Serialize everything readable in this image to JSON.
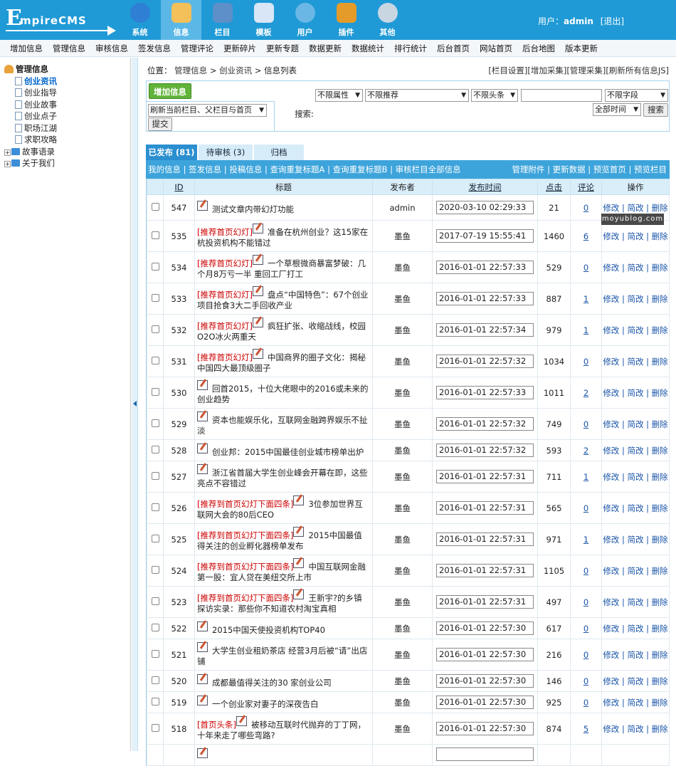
{
  "app": {
    "logo": "EmpireCMS",
    "logo_big": "E",
    "logo_small": "mpireCMS"
  },
  "topnav": [
    {
      "label": "系统",
      "icon": "globe-icon",
      "active": false
    },
    {
      "label": "信息",
      "icon": "edit-note-icon",
      "active": true
    },
    {
      "label": "栏目",
      "icon": "folder-icon",
      "active": false
    },
    {
      "label": "模板",
      "icon": "window-icon",
      "active": false
    },
    {
      "label": "用户",
      "icon": "user-icon",
      "active": false
    },
    {
      "label": "插件",
      "icon": "tools-icon",
      "active": false
    },
    {
      "label": "其他",
      "icon": "gear-icon",
      "active": false
    }
  ],
  "user": {
    "prefix": "用户：",
    "name": "admin",
    "logout": "[退出]"
  },
  "subnav": [
    "增加信息",
    "管理信息",
    "审核信息",
    "签发信息",
    "管理评论",
    "更新碎片",
    "更新专题",
    "数据更新",
    "数据统计",
    "排行统计",
    "后台首页",
    "网站首页",
    "后台地图",
    "版本更新"
  ],
  "tree": {
    "root": "管理信息",
    "items": [
      {
        "label": "创业资讯",
        "type": "doc",
        "selected": true
      },
      {
        "label": "创业指导",
        "type": "doc"
      },
      {
        "label": "创业故事",
        "type": "doc"
      },
      {
        "label": "创业点子",
        "type": "doc"
      },
      {
        "label": "职场江湖",
        "type": "doc"
      },
      {
        "label": "求职攻略",
        "type": "doc"
      },
      {
        "label": "故事语录",
        "type": "folder"
      },
      {
        "label": "关于我们",
        "type": "folder"
      }
    ]
  },
  "location": {
    "prefix": "位置：",
    "crumb1": "管理信息",
    "sep": ">",
    "crumb2": "创业资讯",
    "crumb3": "信息列表"
  },
  "toplinks": [
    "[栏目设置]",
    "[增加采集]",
    "[管理采集]",
    "[刷新所有信息JS]"
  ],
  "actions": {
    "add": "增加信息",
    "refresh_select": "刷新当前栏目、父栏目与首页",
    "submit": "提交",
    "search_label": "搜索:",
    "attr": "不限属性",
    "recommend": "不限推荐",
    "headline": "不限头条",
    "field": "不限字段",
    "time": "全部时间",
    "search_btn": "搜索",
    "keyword_placeholder": ""
  },
  "tabs": [
    {
      "label": "已发布 (81)",
      "active": true
    },
    {
      "label": "待审核 (3)",
      "active": false
    },
    {
      "label": "归档",
      "active": false
    }
  ],
  "listbar": {
    "left": "我的信息 | 签发信息 | 投稿信息 | 查询重复标题A | 查询重复标题B | 审核栏目全部信息",
    "right": "管理附件 | 更新数据 | 预览首页 | 预览栏目"
  },
  "columns": {
    "id": "ID",
    "title": "标题",
    "author": "发布者",
    "time": "发布时间",
    "clicks": "点击",
    "comments": "评论",
    "ops": "操作"
  },
  "ops_text": "修改 | 简改 | 删除",
  "rows": [
    {
      "id": "547",
      "tag": "",
      "title": "测试文章内带幻灯功能",
      "author": "admin",
      "time": "2020-03-10 02:29:33",
      "clicks": "21",
      "comments": "0",
      "h": 36
    },
    {
      "id": "535",
      "tag": "[推荐首页幻灯]",
      "title": "准备在杭州创业？这15家在杭投资机构不能错过",
      "author": "墨鱼",
      "time": "2017-07-19 15:55:41",
      "clicks": "1460",
      "comments": "6",
      "h": 44
    },
    {
      "id": "534",
      "tag": "[推荐首页幻灯]",
      "title": "一个草根微商暴富梦破：几个月8万亏一半 重回工厂打工",
      "author": "墨鱼",
      "time": "2016-01-01 22:57:33",
      "clicks": "529",
      "comments": "0",
      "h": 44
    },
    {
      "id": "533",
      "tag": "[推荐首页幻灯]",
      "title": "盘点“中国特色”：67个创业项目抢食3大二手回收产业",
      "author": "墨鱼",
      "time": "2016-01-01 22:57:33",
      "clicks": "887",
      "comments": "1",
      "h": 44
    },
    {
      "id": "532",
      "tag": "[推荐首页幻灯]",
      "title": "疯狂扩张、收缩战线，校园O2O冰火两重天",
      "author": "墨鱼",
      "time": "2016-01-01 22:57:34",
      "clicks": "979",
      "comments": "1",
      "h": 44
    },
    {
      "id": "531",
      "tag": "[推荐首页幻灯]",
      "title": "中国商界的圈子文化：揭秘中国四大最顶级圈子",
      "author": "墨鱼",
      "time": "2016-01-01 22:57:32",
      "clicks": "1034",
      "comments": "0",
      "h": 44
    },
    {
      "id": "530",
      "tag": "",
      "title": "回首2015，十位大佬眼中的2016或未来的创业趋势",
      "author": "墨鱼",
      "time": "2016-01-01 22:57:33",
      "clicks": "1011",
      "comments": "2",
      "h": 44
    },
    {
      "id": "529",
      "tag": "",
      "title": "资本也能娱乐化，互联网金融跨界娱乐不扯淡",
      "author": "墨鱼",
      "time": "2016-01-01 22:57:32",
      "clicks": "749",
      "comments": "0",
      "h": 44
    },
    {
      "id": "528",
      "tag": "",
      "title": "创业邦：2015中国最佳创业城市榜单出炉",
      "author": "墨鱼",
      "time": "2016-01-01 22:57:32",
      "clicks": "593",
      "comments": "2",
      "h": 30
    },
    {
      "id": "527",
      "tag": "",
      "title": "浙江省首届大学生创业峰会开幕在即，这些亮点不容错过",
      "author": "墨鱼",
      "time": "2016-01-01 22:57:31",
      "clicks": "711",
      "comments": "1",
      "h": 44
    },
    {
      "id": "526",
      "tag": "[推荐到首页幻灯下面四条]",
      "title": "3位参加世界互联网大会的80后CEO",
      "author": "墨鱼",
      "time": "2016-01-01 22:57:31",
      "clicks": "565",
      "comments": "0",
      "h": 44
    },
    {
      "id": "525",
      "tag": "[推荐到首页幻灯下面四条]",
      "title": "2015中国最值得关注的创业孵化器榜单发布",
      "author": "墨鱼",
      "time": "2016-01-01 22:57:31",
      "clicks": "971",
      "comments": "1",
      "h": 44
    },
    {
      "id": "524",
      "tag": "[推荐到首页幻灯下面四条]",
      "title": "中国互联网金融第一股：宜人贷在美纽交所上市",
      "author": "墨鱼",
      "time": "2016-01-01 22:57:31",
      "clicks": "1105",
      "comments": "0",
      "h": 44
    },
    {
      "id": "523",
      "tag": "[推荐到首页幻灯下面四条]",
      "title": "王新宇?的乡镇探访实录：那些你不知道农村淘宝真相",
      "author": "墨鱼",
      "time": "2016-01-01 22:57:31",
      "clicks": "497",
      "comments": "0",
      "h": 44
    },
    {
      "id": "522",
      "tag": "",
      "title": "2015中国天使投资机构TOP40",
      "author": "墨鱼",
      "time": "2016-01-01 22:57:30",
      "clicks": "617",
      "comments": "0",
      "h": 30
    },
    {
      "id": "521",
      "tag": "",
      "title": "大学生创业租奶茶店 经营3月后被“请”出店铺",
      "author": "墨鱼",
      "time": "2016-01-01 22:57:30",
      "clicks": "216",
      "comments": "0",
      "h": 44
    },
    {
      "id": "520",
      "tag": "",
      "title": "成都最值得关注的30 家创业公司",
      "author": "墨鱼",
      "time": "2016-01-01 22:57:30",
      "clicks": "146",
      "comments": "0",
      "h": 30
    },
    {
      "id": "519",
      "tag": "",
      "title": "一个创业家对妻子的深夜告白",
      "author": "墨鱼",
      "time": "2016-01-01 22:57:30",
      "clicks": "925",
      "comments": "0",
      "h": 30
    },
    {
      "id": "518",
      "tag": "[首页头条]",
      "title": "被移动互联时代抛弃的丁丁网，十年来走了哪些弯路?",
      "author": "墨鱼",
      "time": "2016-01-01 22:57:30",
      "clicks": "874",
      "comments": "5",
      "h": 44
    },
    {
      "id": "",
      "tag": "",
      "title": "",
      "author": "",
      "time": "",
      "clicks": "",
      "comments": "",
      "h": 30
    }
  ],
  "watermark": "moyublog.com",
  "colors": {
    "topbar": "#1f9ad6",
    "active_nav": "#5bb8e6",
    "listbar": "#3da4db",
    "tab_active": "#2b8fd0",
    "recommend": "#cc0000",
    "add_button": "#61b33a"
  }
}
